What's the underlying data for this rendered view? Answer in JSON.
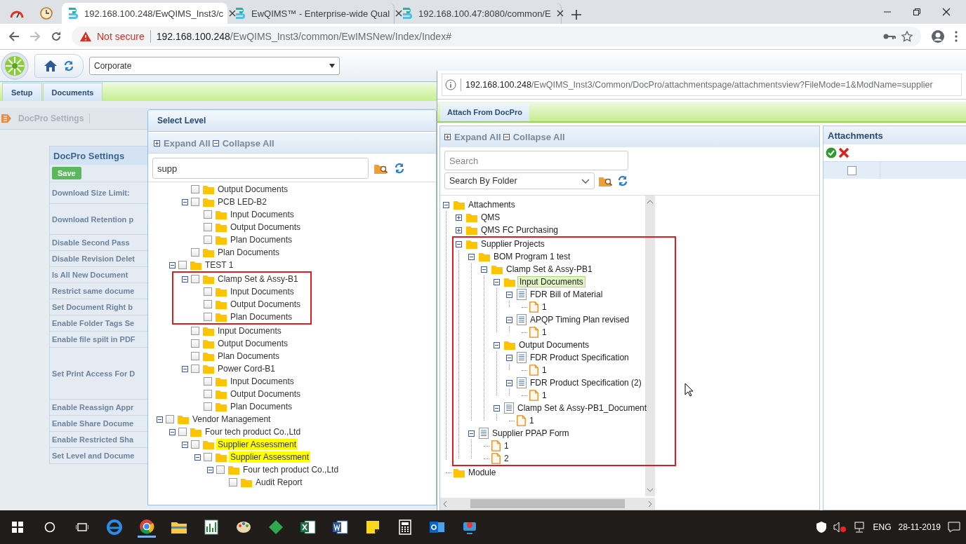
{
  "browser": {
    "tabs": [
      {
        "title": "192.168.100.248/EwQIMS_Inst3/c",
        "selected": true
      },
      {
        "title": "EwQIMS™ - Enterprise-wide Qual",
        "selected": false
      },
      {
        "title": "192.168.100.47:8080/common/E",
        "selected": false
      }
    ],
    "security": "Not secure",
    "url_host": "192.168.100.248",
    "url_path": "/EwQIMS_Inst3/common/EwIMSNew/Index/Index#"
  },
  "app": {
    "location": "Corporate",
    "menu": [
      "Setup",
      "Documents"
    ],
    "breadcrumb": "DocPro Settings",
    "settings": {
      "title": "DocPro Settings",
      "save": "Save",
      "labels": [
        "Download Size Limit:",
        "Download Retention p",
        "Disable Second Pass",
        "Disable Revision Delet",
        "Is All New Document",
        "Restrict same docume",
        "Set Document Right b",
        "Enable Folder Tags Se",
        "Enable file spilt in PDF",
        "Set Print Access For D",
        "Enable Reassign Appr",
        "Enable Share Docume",
        "Enable Restricted Sha",
        "Set Level and Docume"
      ]
    }
  },
  "select_level": {
    "title": "Select Level",
    "expand_all": "Expand All",
    "collapse_all": "Collapse All",
    "search": "supp",
    "tree": [
      {
        "children": [
          {
            "children": [
              {
                "label": "Output Documents",
                "checked": false,
                "highlighted": false,
                "outlined": false
              },
              {
                "label": "PCB LED-B2",
                "checked": false,
                "highlighted": false,
                "outlined": false,
                "expanded": true,
                "children": [
                  {
                    "label": "Input Documents",
                    "checked": false,
                    "highlighted": false,
                    "outlined": false
                  },
                  {
                    "label": "Output Documents",
                    "checked": false,
                    "highlighted": false,
                    "outlined": false
                  },
                  {
                    "label": "Plan Documents",
                    "checked": false,
                    "highlighted": false,
                    "outlined": false
                  }
                ]
              },
              {
                "label": "Plan Documents",
                "checked": false,
                "highlighted": false,
                "outlined": false
              }
            ]
          },
          {
            "label": "TEST 1",
            "checked": false,
            "highlighted": false,
            "outlined": false,
            "expanded": true,
            "children": [
              {
                "label": "Clamp Set & Assy-B1",
                "checked": false,
                "highlighted": false,
                "outlined": true,
                "expanded": true,
                "children": [
                  {
                    "label": "Input Documents",
                    "checked": false,
                    "highlighted": false,
                    "outlined": false
                  },
                  {
                    "label": "Output Documents",
                    "checked": false,
                    "highlighted": false,
                    "outlined": false
                  },
                  {
                    "label": "Plan Documents",
                    "checked": false,
                    "highlighted": false,
                    "outlined": false
                  }
                ]
              },
              {
                "label": "Input Documents",
                "checked": false,
                "highlighted": false,
                "outlined": false
              },
              {
                "label": "Output Documents",
                "checked": false,
                "highlighted": false,
                "outlined": false
              },
              {
                "label": "Plan Documents",
                "checked": false,
                "highlighted": false,
                "outlined": false
              },
              {
                "label": "Power Cord-B1",
                "checked": false,
                "highlighted": false,
                "outlined": false,
                "expanded": true,
                "children": [
                  {
                    "label": "Input Documents",
                    "checked": false,
                    "highlighted": false,
                    "outlined": false
                  },
                  {
                    "label": "Output Documents",
                    "checked": false,
                    "highlighted": false,
                    "outlined": false
                  },
                  {
                    "label": "Plan Documents",
                    "checked": false,
                    "highlighted": false,
                    "outlined": false
                  }
                ]
              }
            ]
          }
        ]
      },
      {
        "label": "Vendor Management",
        "checked": false,
        "highlighted": false,
        "outlined": false,
        "expanded": true,
        "children": [
          {
            "label": "Four tech product Co.,Ltd",
            "checked": false,
            "highlighted": false,
            "outlined": false,
            "expanded": true,
            "children": [
              {
                "label": "Supplier Assessment",
                "checked": false,
                "highlighted": true,
                "outlined": false,
                "expanded": true,
                "children": [
                  {
                    "label": "Supplier Assessment",
                    "checked": false,
                    "highlighted": true,
                    "outlined": false,
                    "expanded": true,
                    "children": [
                      {
                        "label": "Four tech product Co.,Ltd",
                        "checked": false,
                        "highlighted": false,
                        "outlined": false,
                        "expanded": true,
                        "children": [
                          {
                            "label": "Audit Report",
                            "checked": false,
                            "highlighted": false,
                            "outlined": false
                          }
                        ]
                      }
                    ]
                  }
                ]
              }
            ]
          }
        ]
      }
    ]
  },
  "popup": {
    "url_host": "192.168.100.248",
    "url_path": "/EwQIMS_Inst3/Common/DocPro/attachmentspage/attachmentsview?FileMode=1&ModName=supplier",
    "tab": "Attach From DocPro",
    "expand_all": "Expand All",
    "collapse_all": "Collapse All",
    "search_placeholder": "Search",
    "search_by": "Search By Folder",
    "tree": [
      {
        "kind": "folder",
        "label": "Attachments",
        "selected": false,
        "outlined": false,
        "expanded": true,
        "children": [
          {
            "kind": "folder",
            "label": "QMS",
            "selected": false,
            "outlined": false,
            "expanded": false
          },
          {
            "kind": "folder",
            "label": "QMS FC Purchasing",
            "selected": false,
            "outlined": false,
            "expanded": false
          },
          {
            "kind": "folder",
            "label": "Supplier Projects",
            "selected": false,
            "outlined": true,
            "expanded": true,
            "children": [
              {
                "kind": "folder",
                "label": "BOM Program 1 test",
                "selected": false,
                "outlined": false,
                "expanded": true,
                "children": [
                  {
                    "kind": "folder",
                    "label": "Clamp Set & Assy-PB1",
                    "selected": false,
                    "outlined": false,
                    "expanded": true,
                    "children": [
                      {
                        "kind": "folder",
                        "label": "Input Documents",
                        "selected": true,
                        "outlined": false,
                        "expanded": true,
                        "children": [
                          {
                            "kind": "document",
                            "label": "FDR Bill of Material",
                            "selected": false,
                            "outlined": false,
                            "expanded": true,
                            "children": [
                              {
                                "kind": "file",
                                "label": "1",
                                "selected": false,
                                "outlined": false
                              }
                            ]
                          },
                          {
                            "kind": "document",
                            "label": "APQP Timing Plan revised",
                            "selected": false,
                            "outlined": false,
                            "expanded": true,
                            "children": [
                              {
                                "kind": "file",
                                "label": "1",
                                "selected": false,
                                "outlined": false
                              }
                            ]
                          }
                        ]
                      },
                      {
                        "kind": "folder",
                        "label": "Output Documents",
                        "selected": false,
                        "outlined": false,
                        "expanded": true,
                        "children": [
                          {
                            "kind": "document",
                            "label": "FDR Product Specification",
                            "selected": false,
                            "outlined": false,
                            "expanded": true,
                            "children": [
                              {
                                "kind": "file",
                                "label": "1",
                                "selected": false,
                                "outlined": false
                              }
                            ]
                          },
                          {
                            "kind": "document",
                            "label": "FDR Product Specification (2)",
                            "selected": false,
                            "outlined": false,
                            "expanded": true,
                            "children": [
                              {
                                "kind": "file",
                                "label": "1",
                                "selected": false,
                                "outlined": false
                              }
                            ]
                          }
                        ]
                      },
                      {
                        "kind": "document",
                        "label": "Clamp Set & Assy-PB1_Document",
                        "selected": false,
                        "outlined": false,
                        "expanded": true,
                        "children": [
                          {
                            "kind": "file",
                            "label": "1",
                            "selected": false,
                            "outlined": false
                          }
                        ]
                      }
                    ]
                  }
                ]
              },
              {
                "kind": "document",
                "label": "Supplier PPAP Form",
                "selected": false,
                "outlined": false,
                "expanded": true,
                "children": [
                  {
                    "kind": "file",
                    "label": "1",
                    "selected": false,
                    "outlined": false
                  },
                  {
                    "kind": "file",
                    "label": "2",
                    "selected": false,
                    "outlined": false
                  }
                ]
              }
            ]
          }
        ]
      },
      {
        "kind": "folder",
        "label": "Module",
        "selected": false,
        "outlined": false
      }
    ],
    "attachments": {
      "title": "Attachments",
      "rows": [
        {
          "checked": false
        }
      ]
    }
  },
  "taskbar": {
    "language": "ENG",
    "date": "28-11-2019"
  }
}
